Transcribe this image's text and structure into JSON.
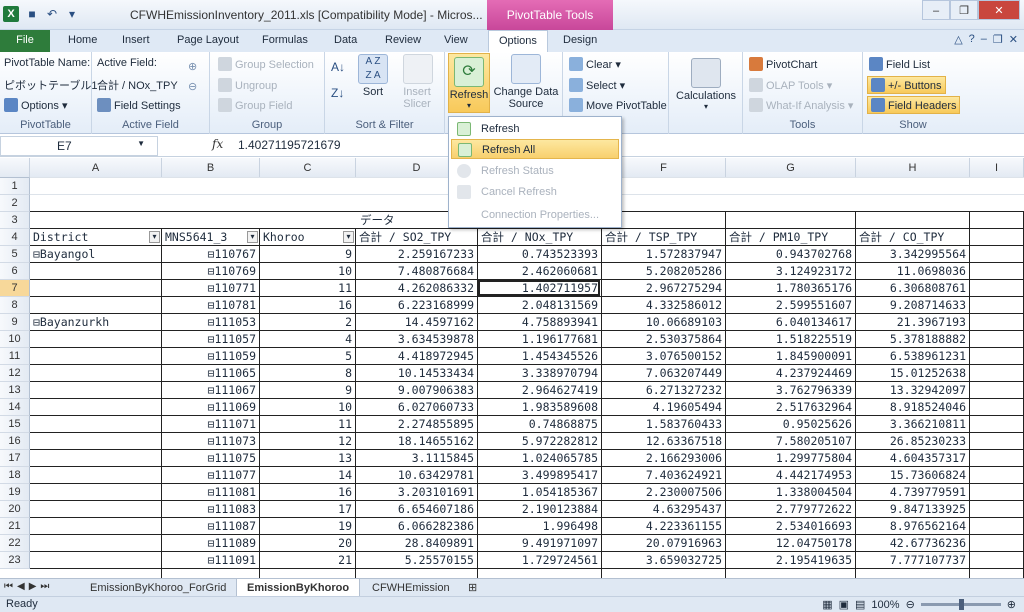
{
  "window": {
    "title": "CFWHEmissionInventory_2011.xls  [Compatibility Mode] - Micros...",
    "contextual_tab_group": "PivotTable Tools"
  },
  "tabs": [
    "File",
    "Home",
    "Insert",
    "Page Layout",
    "Formulas",
    "Data",
    "Review",
    "View",
    "Options",
    "Design"
  ],
  "ribbon": {
    "pivottable": {
      "name_label": "PivotTable Name:",
      "name_value": "ピボットテーブル1",
      "options": "Options",
      "group": "PivotTable"
    },
    "active_field": {
      "label": "Active Field:",
      "value": "合計 / NOx_TPY",
      "settings": "Field Settings",
      "group": "Active Field"
    },
    "group": {
      "selection": "Group Selection",
      "ungroup": "Ungroup",
      "field": "Group Field",
      "group": "Group"
    },
    "sort": {
      "sort": "Sort",
      "insert_slicer": "Insert Slicer",
      "group": "Sort & Filter"
    },
    "data": {
      "refresh": "Refresh",
      "change_source": "Change Data Source",
      "group": "Data"
    },
    "actions": {
      "clear": "Clear",
      "select": "Select",
      "move": "Move PivotTable",
      "group": "Actions"
    },
    "calculations": {
      "label": "Calculations"
    },
    "tools": {
      "pivotchart": "PivotChart",
      "olap": "OLAP Tools",
      "whatif": "What-If Analysis",
      "group": "Tools"
    },
    "show": {
      "field_list": "Field List",
      "buttons": "+/- Buttons",
      "headers": "Field Headers",
      "group": "Show"
    }
  },
  "refresh_menu": [
    "Refresh",
    "Refresh All",
    "Refresh Status",
    "Cancel Refresh",
    "Connection Properties..."
  ],
  "formula_bar": {
    "name_box": "E7",
    "value": "1.40271195721679"
  },
  "columns": [
    "A",
    "B",
    "C",
    "D",
    "E",
    "F",
    "G",
    "H",
    "I"
  ],
  "pivot": {
    "data_label": "データ",
    "headers": [
      "District",
      "MNS5641_3",
      "Khoroo",
      "合計 / SO2_TPY",
      "合計 / NOx_TPY",
      "合計 / TSP_TPY",
      "合計 / PM10_TPY",
      "合計 / CO_TPY"
    ],
    "rows": [
      {
        "n": "5",
        "district": "Bayangol",
        "code": "110767",
        "khoroo": "9",
        "so2": "2.259167233",
        "nox": "0.743523393",
        "tsp": "1.572837947",
        "pm10": "0.943702768",
        "co": "3.342995564"
      },
      {
        "n": "6",
        "district": "",
        "code": "110769",
        "khoroo": "10",
        "so2": "7.480876684",
        "nox": "2.462060681",
        "tsp": "5.208205286",
        "pm10": "3.124923172",
        "co": "11.0698036"
      },
      {
        "n": "7",
        "district": "",
        "code": "110771",
        "khoroo": "11",
        "so2": "4.262086332",
        "nox": "1.402711957",
        "tsp": "2.967275294",
        "pm10": "1.780365176",
        "co": "6.306808761"
      },
      {
        "n": "8",
        "district": "",
        "code": "110781",
        "khoroo": "16",
        "so2": "6.223168999",
        "nox": "2.048131569",
        "tsp": "4.332586012",
        "pm10": "2.599551607",
        "co": "9.208714633"
      },
      {
        "n": "9",
        "district": "Bayanzurkh",
        "code": "111053",
        "khoroo": "2",
        "so2": "14.4597162",
        "nox": "4.758893941",
        "tsp": "10.06689103",
        "pm10": "6.040134617",
        "co": "21.3967193"
      },
      {
        "n": "10",
        "district": "",
        "code": "111057",
        "khoroo": "4",
        "so2": "3.634539878",
        "nox": "1.196177681",
        "tsp": "2.530375864",
        "pm10": "1.518225519",
        "co": "5.378188882"
      },
      {
        "n": "11",
        "district": "",
        "code": "111059",
        "khoroo": "5",
        "so2": "4.418972945",
        "nox": "1.454345526",
        "tsp": "3.076500152",
        "pm10": "1.845900091",
        "co": "6.538961231"
      },
      {
        "n": "12",
        "district": "",
        "code": "111065",
        "khoroo": "8",
        "so2": "10.14533434",
        "nox": "3.338970794",
        "tsp": "7.063207449",
        "pm10": "4.237924469",
        "co": "15.01252638"
      },
      {
        "n": "13",
        "district": "",
        "code": "111067",
        "khoroo": "9",
        "so2": "9.007906383",
        "nox": "2.964627419",
        "tsp": "6.271327232",
        "pm10": "3.762796339",
        "co": "13.32942097"
      },
      {
        "n": "14",
        "district": "",
        "code": "111069",
        "khoroo": "10",
        "so2": "6.027060733",
        "nox": "1.983589608",
        "tsp": "4.19605494",
        "pm10": "2.517632964",
        "co": "8.918524046"
      },
      {
        "n": "15",
        "district": "",
        "code": "111071",
        "khoroo": "11",
        "so2": "2.274855895",
        "nox": "0.74868875",
        "tsp": "1.583760433",
        "pm10": "0.95025626",
        "co": "3.366210811"
      },
      {
        "n": "16",
        "district": "",
        "code": "111073",
        "khoroo": "12",
        "so2": "18.14655162",
        "nox": "5.972282812",
        "tsp": "12.63367518",
        "pm10": "7.580205107",
        "co": "26.85230233"
      },
      {
        "n": "17",
        "district": "",
        "code": "111075",
        "khoroo": "13",
        "so2": "3.1115845",
        "nox": "1.024065785",
        "tsp": "2.166293006",
        "pm10": "1.299775804",
        "co": "4.604357317"
      },
      {
        "n": "18",
        "district": "",
        "code": "111077",
        "khoroo": "14",
        "so2": "10.63429781",
        "nox": "3.499895417",
        "tsp": "7.403624921",
        "pm10": "4.442174953",
        "co": "15.73606824"
      },
      {
        "n": "19",
        "district": "",
        "code": "111081",
        "khoroo": "16",
        "so2": "3.203101691",
        "nox": "1.054185367",
        "tsp": "2.230007506",
        "pm10": "1.338004504",
        "co": "4.739779591"
      },
      {
        "n": "20",
        "district": "",
        "code": "111083",
        "khoroo": "17",
        "so2": "6.654607186",
        "nox": "2.190123884",
        "tsp": "4.63295437",
        "pm10": "2.779772622",
        "co": "9.847133925"
      },
      {
        "n": "21",
        "district": "",
        "code": "111087",
        "khoroo": "19",
        "so2": "6.066282386",
        "nox": "1.996498",
        "tsp": "4.223361155",
        "pm10": "2.534016693",
        "co": "8.976562164"
      },
      {
        "n": "22",
        "district": "",
        "code": "111089",
        "khoroo": "20",
        "so2": "28.8409891",
        "nox": "9.491971097",
        "tsp": "20.07916963",
        "pm10": "12.04750178",
        "co": "42.67736236"
      },
      {
        "n": "23",
        "district": "",
        "code": "111091",
        "khoroo": "21",
        "so2": "5.25570155",
        "nox": "1.729724561",
        "tsp": "3.659032725",
        "pm10": "2.195419635",
        "co": "7.777107737"
      }
    ]
  },
  "sheets": [
    "EmissionByKhoroo_ForGrid",
    "EmissionByKhoroo",
    "CFWHEmission"
  ],
  "status": {
    "ready": "Ready",
    "zoom": "100%"
  }
}
